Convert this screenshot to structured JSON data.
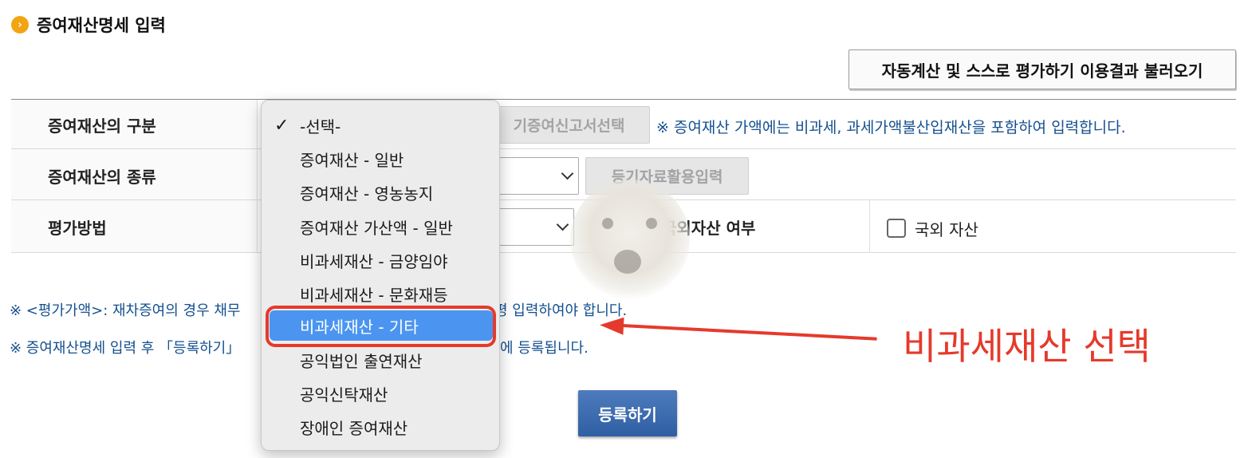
{
  "header": {
    "icon": "chevron-right-circle",
    "icon_glyph": "›",
    "title": "증여재산명세 입력"
  },
  "load_button_label": "자동계산 및 스스로 평가하기 이용결과 불러오기",
  "form": {
    "row1": {
      "label": "증여재산의 구분",
      "button_label": "기증여신고서선택",
      "note": "※ 증여재산 가액에는 비과세, 과세가액불산입재산을 포함하여 입력합니다."
    },
    "row2": {
      "label": "증여재산의 종류",
      "button_label": "등기자료활용입력"
    },
    "row3": {
      "label": "평가방법",
      "foreign_label": "국외자산 여부",
      "checkbox_label": "국외 자산",
      "checkbox_checked": false
    }
  },
  "notes": [
    "※ <평가가액>: 재차증여의 경우 채무",
    "평 입력하여야 합니다.",
    "※ 증여재산명세 입력 후 「등록하기」",
    "에 등록됩니다."
  ],
  "submit_label": "등록하기",
  "dropdown": {
    "options": [
      "-선택-",
      "증여재산 - 일반",
      "증여재산 - 영농농지",
      "증여재산 가산액 - 일반",
      "비과세재산 - 금양임야",
      "비과세재산 - 문화재등",
      "비과세재산 - 기타",
      "공익법인 출연재산",
      "공익신탁재산",
      "장애인 증여재산"
    ],
    "checked_index": 0,
    "highlighted_index": 6,
    "checkmark_glyph": "✓"
  },
  "annotation": {
    "text": "비과세재산 선택",
    "color": "#e53a2b"
  }
}
